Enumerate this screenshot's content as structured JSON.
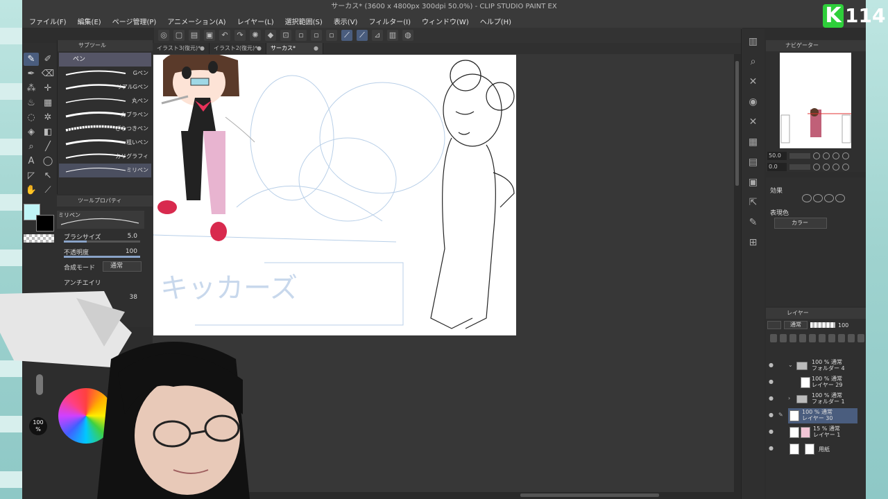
{
  "window": {
    "title": "サーカス* (3600 x 4800px 300dpi 50.0%) - CLIP STUDIO PAINT EX"
  },
  "menu": [
    "ファイル(F)",
    "編集(E)",
    "ページ管理(P)",
    "アニメーション(A)",
    "レイヤー(L)",
    "選択範囲(S)",
    "表示(V)",
    "フィルター(I)",
    "ウィンドウ(W)",
    "ヘルプ(H)"
  ],
  "tabs": [
    {
      "label": "イラスト3(復元)*"
    },
    {
      "label": "イラスト2(復元)*"
    },
    {
      "label": "サーカス*"
    }
  ],
  "subtool": {
    "header": "サブツール",
    "group": "ペン",
    "brushes": [
      "Gペン",
      "リアルGペン",
      "丸ペン",
      "カブラペン",
      "ざらつきペン",
      "粗いペン",
      "カリグラフィ",
      "ミリペン"
    ],
    "selected_index": 7
  },
  "toolprop": {
    "header": "ツールプロパティ",
    "brush_name": "ミリペン",
    "brush_size_label": "ブラシサイズ",
    "brush_size_value": "5.0",
    "opacity_label": "不透明度",
    "opacity_value": "100",
    "blend_label": "合成モード",
    "blend_value": "通常",
    "aa_label": "アンチエイリ",
    "stab_value": "38"
  },
  "colors": {
    "main": "#bff4f6",
    "sub": "#000000",
    "accent": "#4a5d7e"
  },
  "navigator": {
    "header": "ナビゲーター",
    "zoom_value": "50.0",
    "rotate_value": "0.0"
  },
  "effect": {
    "title": "効果",
    "expression_label": "表現色",
    "expression_value": "カラー"
  },
  "layers": {
    "header": "レイヤー",
    "blend_mode": "通常",
    "opacity": "100",
    "items": [
      {
        "meta": "100 % 通常",
        "name": "フォルダー 4",
        "type": "folder",
        "expanded": true
      },
      {
        "meta": "100 % 通常",
        "name": "レイヤー 29",
        "type": "layer"
      },
      {
        "meta": "100 % 通常",
        "name": "フォルダー 1",
        "type": "folder",
        "expanded": false
      },
      {
        "meta": "100 % 通常",
        "name": "レイヤー 30",
        "type": "layer",
        "selected": true
      },
      {
        "meta": "15 % 通常",
        "name": "レイヤー 1",
        "type": "layer"
      },
      {
        "meta": "",
        "name": "用紙",
        "type": "paper"
      }
    ]
  },
  "wheel": {
    "percent": "100",
    "unit": "%"
  },
  "overlay": {
    "letter": "K",
    "number": "114"
  },
  "canvas_text": "キッカーズ"
}
